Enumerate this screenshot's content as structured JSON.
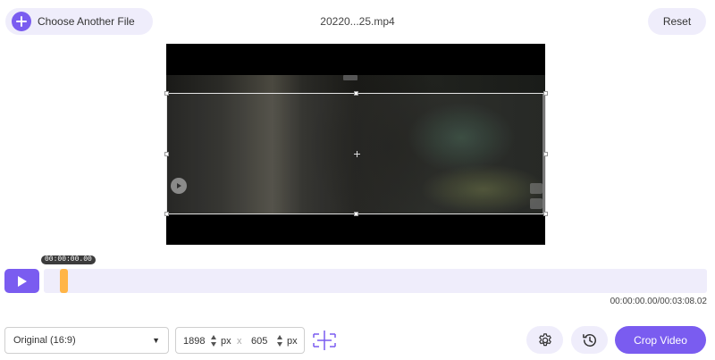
{
  "header": {
    "choose_label": "Choose Another File",
    "file_name": "20220...25.mp4",
    "reset_label": "Reset"
  },
  "player": {
    "current_badge": "00:00:00.00",
    "time_readout": "00:00:00.00/00:03:08.02",
    "progress_fraction": 0
  },
  "controls": {
    "aspect_value": "Original (16:9)",
    "width_value": "1898",
    "height_value": "605",
    "unit": "px",
    "separator": "x",
    "crop_label": "Crop Video"
  },
  "colors": {
    "accent": "#7a5cf0",
    "accent_light": "#efedfb",
    "thumb": "#ffb547"
  },
  "icons": {
    "choose": "plus-icon",
    "play": "play-icon",
    "center": "center-align-icon",
    "settings": "gear-icon",
    "history": "history-icon",
    "aspect_arrow": "triangle-down-icon"
  }
}
